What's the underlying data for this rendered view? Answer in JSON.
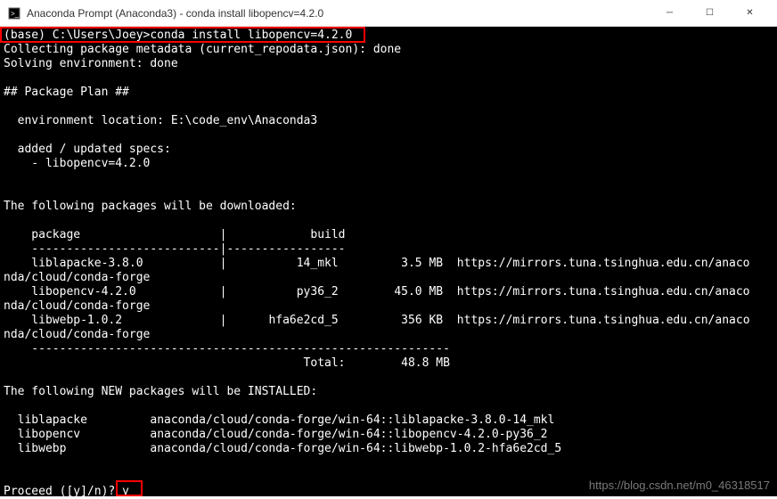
{
  "window": {
    "title": "Anaconda Prompt (Anaconda3) - conda  install libopencv=4.2.0"
  },
  "terminal": {
    "prompt_line": "(base) C:\\Users\\Joey>conda install libopencv=4.2.0",
    "collecting": "Collecting package metadata (current_repodata.json): done",
    "solving": "Solving environment: done",
    "plan_header": "## Package Plan ##",
    "env_location": "  environment location: E:\\code_env\\Anaconda3",
    "added_specs_header": "  added / updated specs:",
    "added_specs": "    - libopencv=4.2.0",
    "download_header": "The following packages will be downloaded:",
    "col_package": "    package",
    "col_build": "build",
    "packages": [
      {
        "name": "    liblapacke-3.8.0",
        "build": "14_mkl",
        "size": "3.5 MB",
        "url": "https://mirrors.tuna.tsinghua.edu.cn/anaco"
      },
      {
        "name": "    libopencv-4.2.0",
        "build": "py36_2",
        "size": "45.0 MB",
        "url": "https://mirrors.tuna.tsinghua.edu.cn/anaco"
      },
      {
        "name": "    libwebp-1.0.2",
        "build": "hfa6e2cd_5",
        "size": "356 KB",
        "url": "https://mirrors.tuna.tsinghua.edu.cn/anaco"
      }
    ],
    "channel_line": "nda/cloud/conda-forge",
    "total_label": "Total:",
    "total_size": "48.8 MB",
    "install_header": "The following NEW packages will be INSTALLED:",
    "installs": [
      {
        "name": "  liblapacke",
        "spec": "anaconda/cloud/conda-forge/win-64::liblapacke-3.8.0-14_mkl"
      },
      {
        "name": "  libopencv",
        "spec": "anaconda/cloud/conda-forge/win-64::libopencv-4.2.0-py36_2"
      },
      {
        "name": "  libwebp",
        "spec": "anaconda/cloud/conda-forge/win-64::libwebp-1.0.2-hfa6e2cd_5"
      }
    ],
    "proceed_prompt": "Proceed ([y]/n)?",
    "proceed_input": " y"
  },
  "watermark": "https://blog.csdn.net/m0_46318517"
}
